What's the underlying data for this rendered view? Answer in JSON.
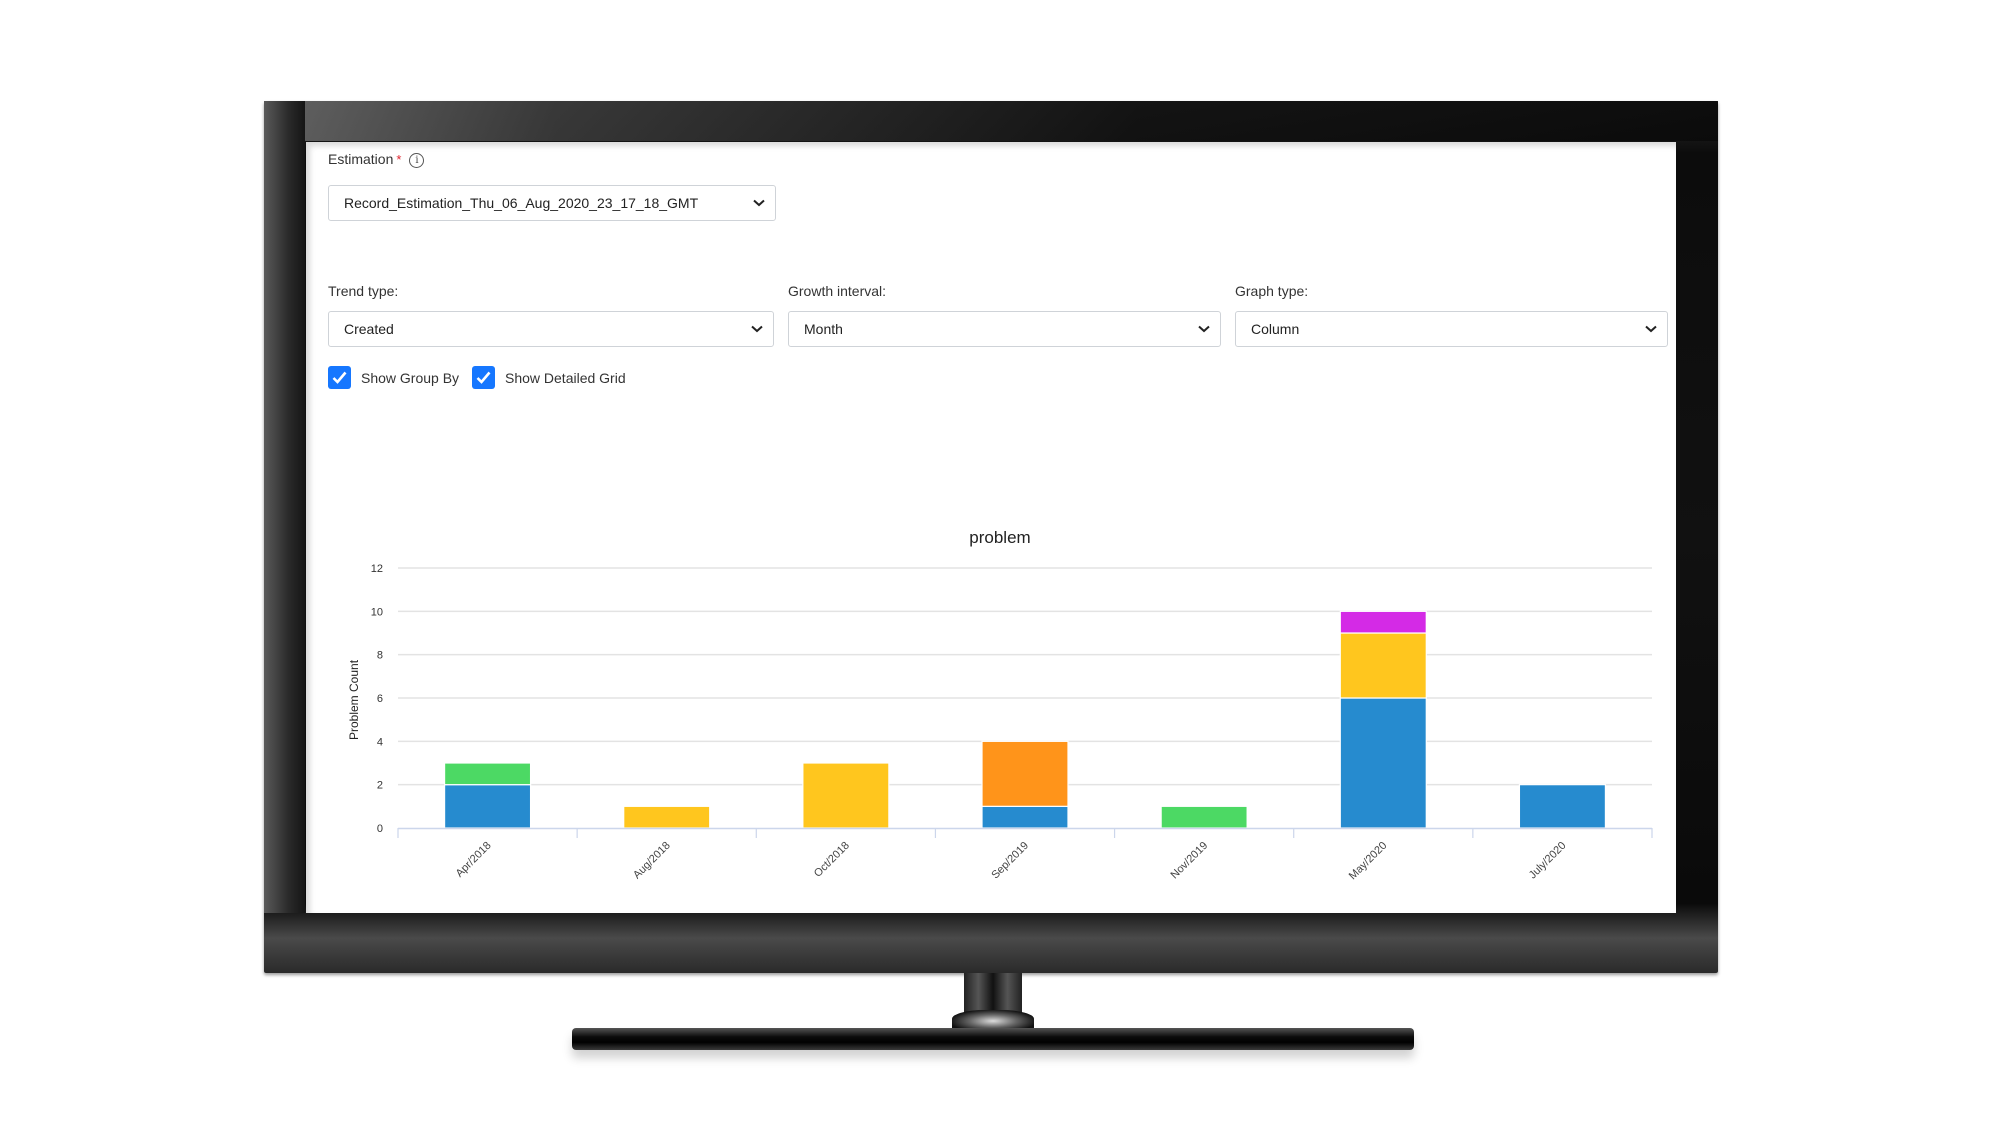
{
  "form": {
    "estimation": {
      "label": "Estimation",
      "required_mark": "*",
      "info_icon": "info-circle-icon",
      "selected": "Record_Estimation_Thu_06_Aug_2020_23_17_18_GMT"
    },
    "trend_type": {
      "label": "Trend type:",
      "selected": "Created"
    },
    "growth_interval": {
      "label": "Growth interval:",
      "selected": "Month"
    },
    "graph_type": {
      "label": "Graph type:",
      "selected": "Column"
    },
    "show_group_by": {
      "label": "Show Group By",
      "checked": true
    },
    "show_detailed_grid": {
      "label": "Show Detailed Grid",
      "checked": true
    }
  },
  "chart_data": {
    "type": "bar",
    "stacked": true,
    "title": "problem",
    "xlabel": "",
    "ylabel": "Problem Count",
    "ylim": [
      0,
      12
    ],
    "yticks": [
      "0",
      "2",
      "4",
      "6",
      "8",
      "10",
      "12"
    ],
    "grid": true,
    "legend": "none",
    "categories": [
      "Apr/2018",
      "Aug/2018",
      "Oct/2018",
      "Sep/2019",
      "Nov/2019",
      "May/2020",
      "July/2020"
    ],
    "series": [
      {
        "name": "blue",
        "color": "#268bcf",
        "values": [
          2,
          0,
          0,
          1,
          0,
          6,
          2
        ]
      },
      {
        "name": "green",
        "color": "#4cd964",
        "values": [
          1,
          0,
          0,
          0,
          1,
          0,
          0
        ]
      },
      {
        "name": "yellow",
        "color": "#ffc61e",
        "values": [
          0,
          1,
          3,
          0,
          0,
          3,
          0
        ]
      },
      {
        "name": "orange",
        "color": "#ff941a",
        "values": [
          0,
          0,
          0,
          3,
          0,
          0,
          0
        ]
      },
      {
        "name": "magenta",
        "color": "#d42ae6",
        "values": [
          0,
          0,
          0,
          0,
          0,
          1,
          0
        ]
      }
    ]
  }
}
